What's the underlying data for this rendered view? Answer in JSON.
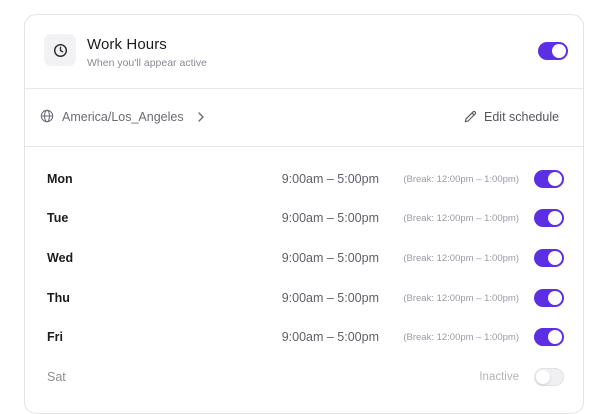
{
  "header": {
    "title": "Work Hours",
    "subtitle": "When you'll appear active",
    "enabled": true,
    "icon": "clock-icon"
  },
  "timezone": {
    "label": "America/Los_Angeles",
    "icon": "globe-icon",
    "edit_label": "Edit schedule",
    "edit_icon": "pencil-icon"
  },
  "days": [
    {
      "name": "Mon",
      "hours": "9:00am – 5:00pm",
      "break": "(Break: 12:00pm – 1:00pm)",
      "enabled": true
    },
    {
      "name": "Tue",
      "hours": "9:00am – 5:00pm",
      "break": "(Break: 12:00pm – 1:00pm)",
      "enabled": true
    },
    {
      "name": "Wed",
      "hours": "9:00am – 5:00pm",
      "break": "(Break: 12:00pm – 1:00pm)",
      "enabled": true
    },
    {
      "name": "Thu",
      "hours": "9:00am – 5:00pm",
      "break": "(Break: 12:00pm – 1:00pm)",
      "enabled": true
    },
    {
      "name": "Fri",
      "hours": "9:00am – 5:00pm",
      "break": "(Break: 12:00pm – 1:00pm)",
      "enabled": true
    },
    {
      "name": "Sat",
      "status": "Inactive",
      "enabled": false
    }
  ],
  "colors": {
    "accent": "#5b2fe4",
    "toggle_off": "#f0f0f2"
  }
}
